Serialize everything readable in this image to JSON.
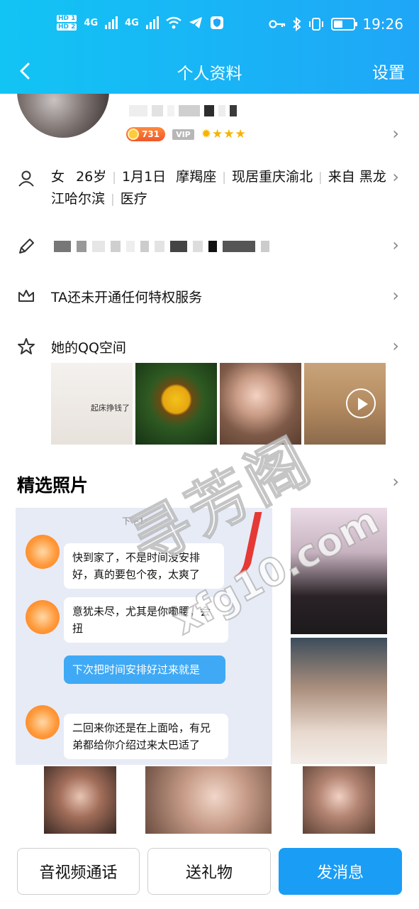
{
  "status_bar": {
    "hd1": "HD 1",
    "hd2": "HD 2",
    "net1": "4G",
    "net2": "4G",
    "time": "19:26"
  },
  "nav": {
    "title": "个人资料",
    "settings_label": "设置"
  },
  "profile": {
    "coin_count": "731",
    "vip_label": "VIP",
    "level_icons": [
      "sun-icon",
      "star-icon",
      "star-icon",
      "star-icon"
    ]
  },
  "info": {
    "gender": "女",
    "age": "26岁",
    "birthday": "1月1日",
    "zodiac": "摩羯座",
    "residence": "现居重庆渝北",
    "hometown_prefix": "来自",
    "hometown": "黑龙江哈尔滨",
    "occupation": "医疗"
  },
  "privilege": {
    "label": "TA还未开通任何特权服务"
  },
  "qzone": {
    "label": "她的QQ空间",
    "photo_caption": "起床挣钱了"
  },
  "featured": {
    "title": "精选照片",
    "chat_time": "下午1:",
    "messages": [
      "快到家了，不是时间没安排好，真的要包个夜，太爽了",
      "意犹未尽，尤其是你嘞腰，会扭",
      "下次把时间安排好过来就是",
      "二回来你还是在上面哈，有兄弟都给你介绍过来太巴适了"
    ]
  },
  "watermark": {
    "line1": "寻芳阁",
    "line2": "xfg10.com"
  },
  "actions": {
    "av_call": "音视频通话",
    "gift": "送礼物",
    "message": "发消息"
  },
  "colors": {
    "accent": "#1fa6f7",
    "primary_button": "#1a9df5"
  }
}
